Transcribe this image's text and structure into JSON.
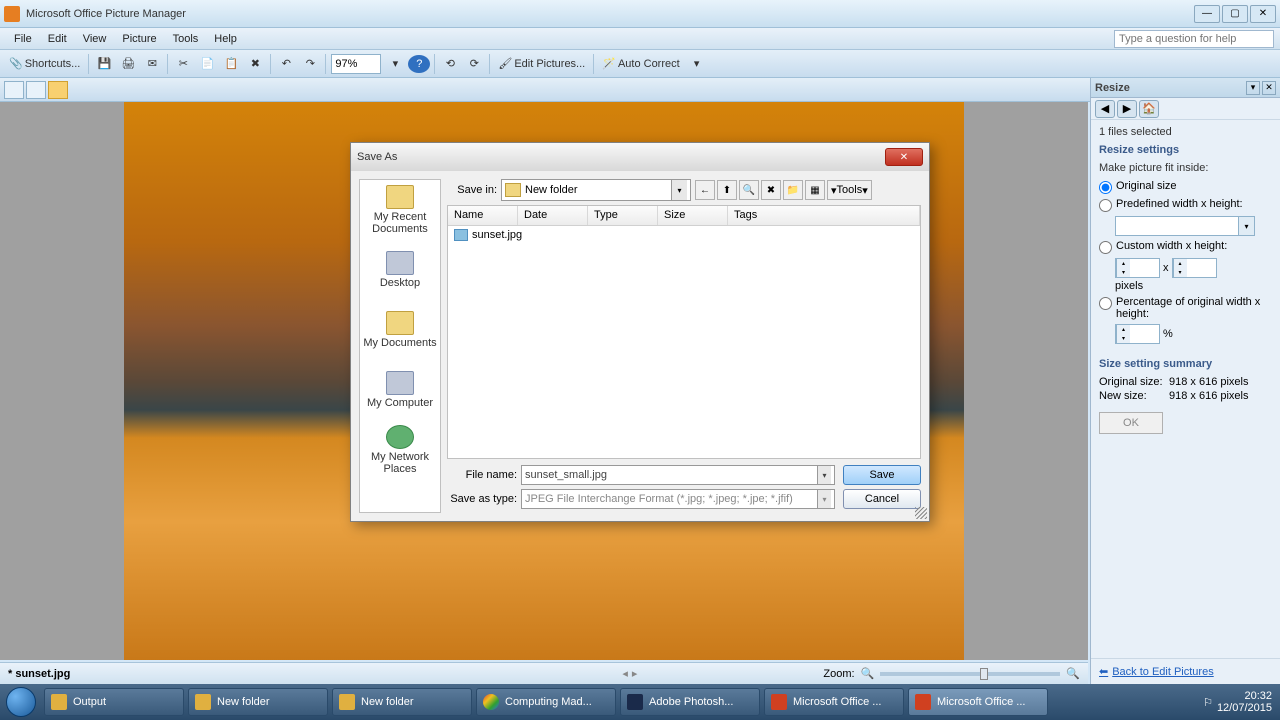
{
  "app": {
    "title": "Microsoft Office Picture Manager"
  },
  "menus": [
    "File",
    "Edit",
    "View",
    "Picture",
    "Tools",
    "Help"
  ],
  "help_search": {
    "placeholder": "Type a question for help"
  },
  "toolbar": {
    "shortcuts": "Shortcuts...",
    "zoom": "97%",
    "edit_pictures": "Edit Pictures...",
    "auto_correct": "Auto Correct"
  },
  "status": {
    "filename": "* sunset.jpg",
    "zoom_label": "Zoom:"
  },
  "taskpane": {
    "title": "Resize",
    "files_selected": "1 files selected",
    "section_resize": "Resize settings",
    "fit_label": "Make picture fit inside:",
    "opt_original": "Original size",
    "opt_predefined": "Predefined width x height:",
    "opt_custom": "Custom width x height:",
    "pixels": "pixels",
    "x": "x",
    "opt_percentage": "Percentage of original width x height:",
    "pct": "%",
    "section_summary": "Size setting summary",
    "orig_label": "Original size:",
    "orig_val": "918 x 616 pixels",
    "new_label": "New size:",
    "new_val": "918 x 616 pixels",
    "ok": "OK",
    "back": "Back to Edit Pictures"
  },
  "dialog": {
    "title": "Save As",
    "savein_label": "Save in:",
    "savein_value": "New folder",
    "tools_label": "Tools",
    "columns": {
      "name": "Name",
      "date": "Date",
      "type": "Type",
      "size": "Size",
      "tags": "Tags"
    },
    "files": [
      {
        "name": "sunset.jpg"
      }
    ],
    "places": [
      "My Recent Documents",
      "Desktop",
      "My Documents",
      "My Computer",
      "My Network Places"
    ],
    "filename_label": "File name:",
    "filename_value": "sunset_small.jpg",
    "savetype_label": "Save as type:",
    "savetype_value": "JPEG File Interchange Format (*.jpg; *.jpeg; *.jpe; *.jfif)",
    "save": "Save",
    "cancel": "Cancel"
  },
  "taskbar": {
    "items": [
      "Output",
      "New folder",
      "New folder",
      "Computing Mad...",
      "Adobe Photosh...",
      "Microsoft Office ...",
      "Microsoft Office ..."
    ],
    "time": "20:32",
    "date": "12/07/2015"
  }
}
